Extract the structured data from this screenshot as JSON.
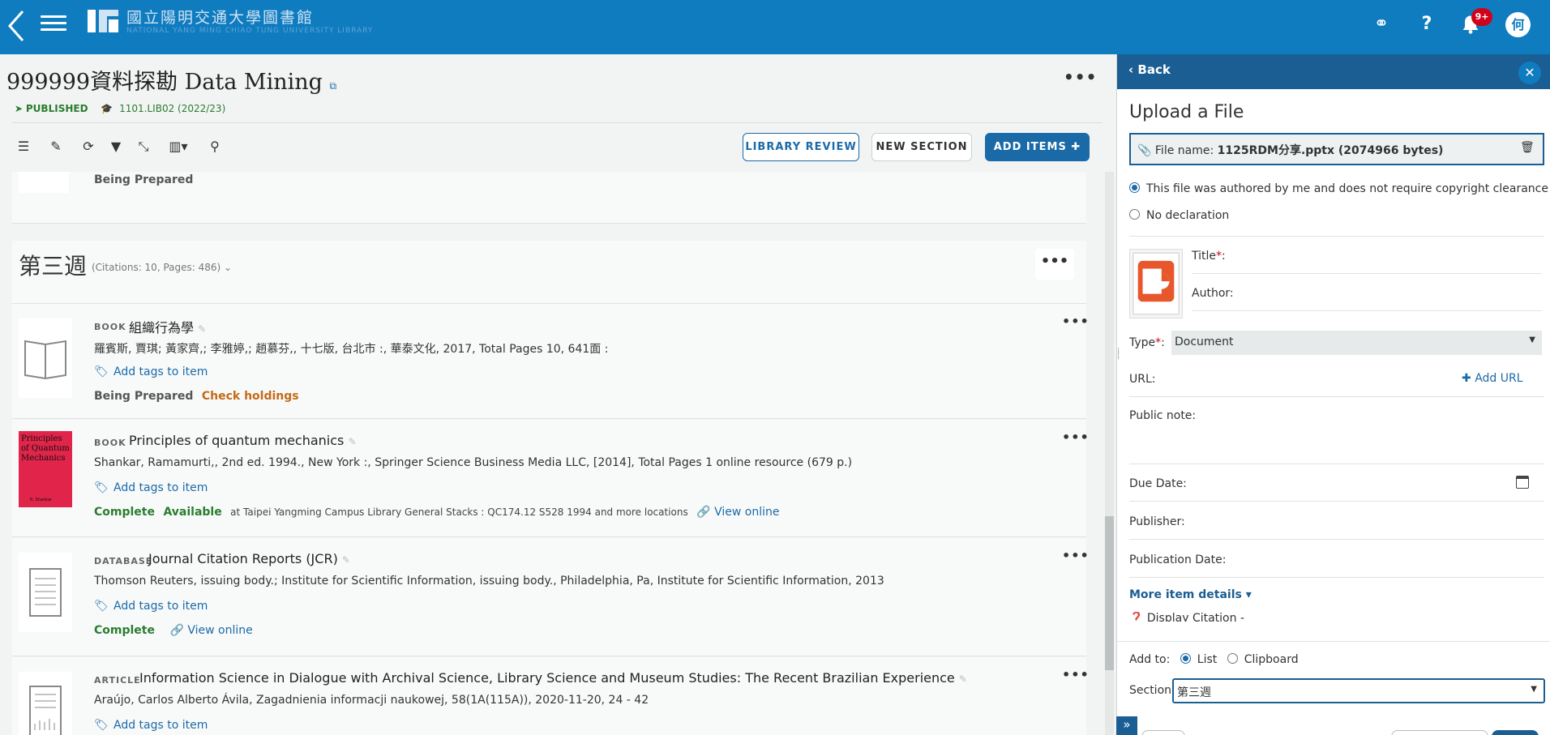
{
  "header": {
    "org_title": "國立陽明交通大學圖書館",
    "org_subtitle": "NATIONAL YANG MING CHIAO TUNG UNIVERSITY LIBRARY",
    "notification_count": "9+",
    "user_initial": "何"
  },
  "list": {
    "title": "999999資料探勘 Data Mining",
    "status": "PUBLISHED",
    "course": "1101.LIB02 (2022/23)",
    "more": "•••",
    "buttons": {
      "library_review": "LIBRARY REVIEW",
      "new_section": "NEW SECTION",
      "add_items": "ADD ITEMS"
    }
  },
  "previous_item_status": "Being Prepared",
  "section": {
    "title": "第三週",
    "meta": "(Citations: 10, Pages: 486)",
    "more": "•••"
  },
  "items": [
    {
      "kind": "BOOK",
      "title": "組織行為學",
      "meta": "羅賓斯, 賈琪; 黃家齊,; 李雅婷,; 趙慕芬,, 十七版, 台北市 :, 華泰文化, 2017, Total Pages 10, 641面 :",
      "tags": "Add tags to item",
      "status": "Being Prepared",
      "action": "Check holdings"
    },
    {
      "kind": "BOOK",
      "title": "Principles of quantum mechanics",
      "meta": "Shankar, Ramamurti,, 2nd ed. 1994., New York :, Springer Science Business Media LLC, [2014], Total Pages 1 online resource (679 p.)",
      "tags": "Add tags to item",
      "status": "Complete",
      "availability": "Available",
      "location": "at Taipei Yangming Campus Library General Stacks : QC174.12 S528 1994 and more locations",
      "link": "View online",
      "cover_title": "Principles of Quantum Mechanics",
      "cover_author": "R. Shankar"
    },
    {
      "kind": "DATABASE",
      "title": "Journal Citation Reports (JCR)",
      "meta": "Thomson Reuters, issuing body.; Institute for Scientific Information, issuing body., Philadelphia, Pa, Institute for Scientific Information, 2013",
      "tags": "Add tags to item",
      "status": "Complete",
      "link": "View online"
    },
    {
      "kind": "ARTICLE",
      "title": "Information Science in Dialogue with Archival Science, Library Science and Museum Studies: The Recent Brazilian Experience",
      "meta": "Araújo, Carlos Alberto Ávila, Zagadnienia informacji naukowej, 58(1A(115A)), 2020-11-20, 24 - 42",
      "tags": "Add tags to item"
    }
  ],
  "panel": {
    "back": "Back",
    "heading": "Upload a File",
    "file_label": "File name:",
    "file_value": "1125RDM分享.pptx (2074966 bytes)",
    "radio_authored": "This file was authored by me and does not require copyright clearance",
    "radio_none": "No declaration",
    "title_label": "Title",
    "author_label": "Author:",
    "type_label": "Type",
    "type_value": "Document",
    "url_label": "URL:",
    "add_url": "Add URL",
    "public_note_label": "Public note:",
    "due_date_label": "Due Date:",
    "publisher_label": "Publisher:",
    "publication_date_label": "Publication Date:",
    "more_details": "More item details",
    "display_citation": "Display Citation -",
    "add_to_label": "Add to:",
    "add_to_list": "List",
    "add_to_clipboard": "Clipboard",
    "section_label": "Section:",
    "section_value": "第三週"
  },
  "colors": {
    "brand_blue": "#0f7cc0",
    "panel_header": "#1b5e93",
    "link_blue": "#1b6aa8",
    "status_green": "#2a7d2e",
    "action_orange": "#c56a14"
  }
}
